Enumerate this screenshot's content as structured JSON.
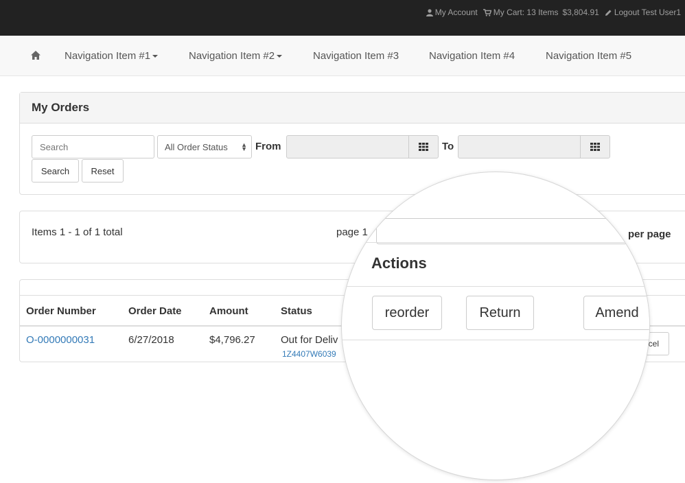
{
  "topbar": {
    "my_account": "My Account",
    "my_cart": "My Cart: 13 Items",
    "cart_total": "$3,804.91",
    "logout": "Logout Test User1"
  },
  "nav": {
    "home_icon": "home-icon",
    "items": [
      {
        "label": "Navigation Item #1"
      },
      {
        "label": "Navigation Item #2"
      },
      {
        "label": "Navigation Item #3"
      },
      {
        "label": "Navigation Item #4"
      },
      {
        "label": "Navigation Item #5"
      }
    ]
  },
  "orders": {
    "title": "My Orders",
    "search_placeholder": "Search",
    "status_select": "All Order Status",
    "from_label": "From",
    "to_label": "To",
    "search_button": "Search",
    "reset_button": "Reset"
  },
  "pagination": {
    "items_text": "Items 1 - 1 of 1 total",
    "page_text": "page 1",
    "per_page": "per page"
  },
  "table": {
    "headers": [
      "Order Number",
      "Order Date",
      "Amount",
      "Status"
    ],
    "rows": [
      {
        "order_number": "O-0000000031",
        "order_date": "6/27/2018",
        "amount": "$4,796.27",
        "status": "Out for Deliv",
        "tracking": "1Z4407W6039",
        "cancel_partial": "cel"
      }
    ]
  },
  "magnifier": {
    "actions_title": "Actions",
    "buttons": [
      "reorder",
      "Return",
      "Amend"
    ]
  },
  "colors": {
    "topbar_bg": "#222222",
    "nav_bg": "#f8f8f8",
    "link": "#337ab7"
  }
}
